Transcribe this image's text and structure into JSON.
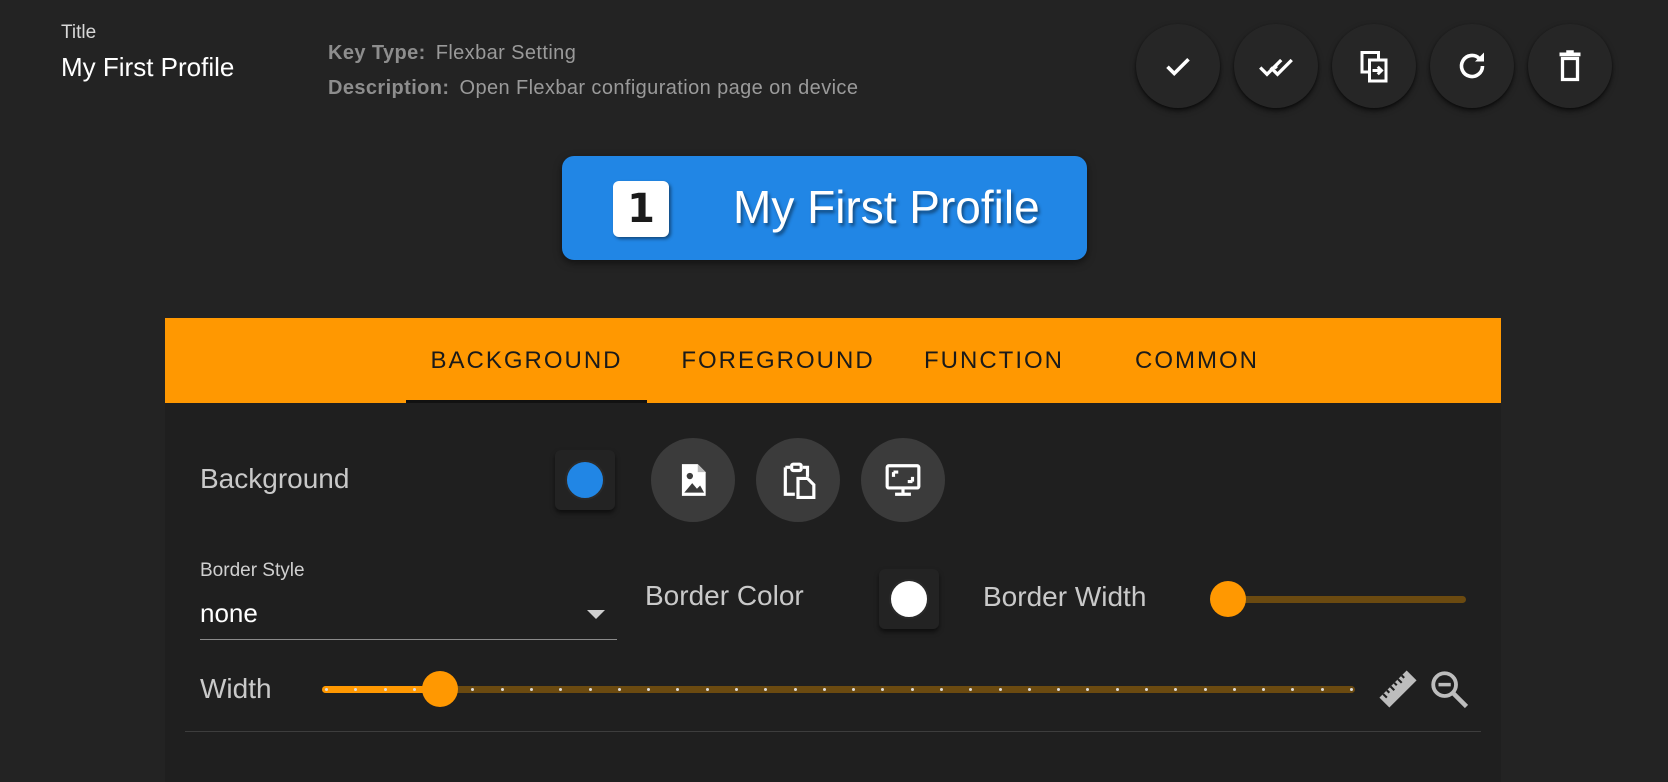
{
  "header": {
    "title_label": "Title",
    "title_value": "My First Profile",
    "key_type_label": "Key Type:",
    "key_type_value": "Flexbar Setting",
    "description_label": "Description:",
    "description_value": "Open Flexbar configuration page on device"
  },
  "actions": [
    {
      "name": "check-icon"
    },
    {
      "name": "double-check-icon"
    },
    {
      "name": "copy-icon"
    },
    {
      "name": "refresh-icon"
    },
    {
      "name": "trash-icon"
    }
  ],
  "preview": {
    "number": "1",
    "label": "My First Profile",
    "background": "#2186e5"
  },
  "tabs": [
    "BACKGROUND",
    "FOREGROUND",
    "FUNCTION",
    "COMMON"
  ],
  "active_tab": "BACKGROUND",
  "background_section": {
    "label": "Background",
    "color": "#2186e5",
    "buttons": [
      "image-file-icon",
      "paste-icon",
      "screen-icon"
    ]
  },
  "border": {
    "style_label": "Border Style",
    "style_value": "none",
    "color_label": "Border Color",
    "color_value": "#ffffff",
    "width_label": "Border Width",
    "width_value": 0
  },
  "width": {
    "label": "Width",
    "value_fraction": 0.114
  },
  "tools": [
    "ruler-icon",
    "zoom-out-icon"
  ],
  "colors": {
    "accent": "#ff9801",
    "background": "#232323",
    "panel": "#1f1f1f"
  }
}
